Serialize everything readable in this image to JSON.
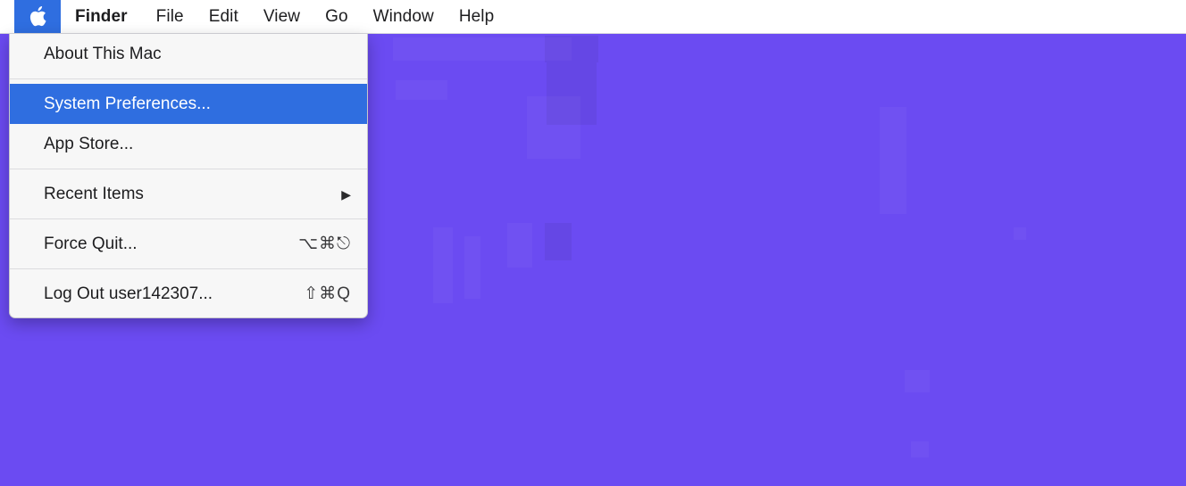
{
  "desktop": {
    "background_color": "#6b4bf2"
  },
  "menubar": {
    "apple_icon": "apple-logo-icon",
    "highlight_color": "#2f6ee0",
    "items": [
      {
        "label": "Finder",
        "bold": true
      },
      {
        "label": "File",
        "bold": false
      },
      {
        "label": "Edit",
        "bold": false
      },
      {
        "label": "View",
        "bold": false
      },
      {
        "label": "Go",
        "bold": false
      },
      {
        "label": "Window",
        "bold": false
      },
      {
        "label": "Help",
        "bold": false
      }
    ]
  },
  "apple_menu": {
    "selected_item": "System Preferences...",
    "items": [
      {
        "label": "About This Mac",
        "shortcut": "",
        "submenu": false,
        "selected": false
      },
      {
        "label": "System Preferences...",
        "shortcut": "",
        "submenu": false,
        "selected": true
      },
      {
        "label": "App Store...",
        "shortcut": "",
        "submenu": false,
        "selected": false
      },
      {
        "label": "Recent Items",
        "shortcut": "",
        "submenu": true,
        "selected": false
      },
      {
        "label": "Force Quit...",
        "shortcut": "⌥⌘⎋",
        "submenu": false,
        "selected": false
      },
      {
        "label": "Log Out user142307...",
        "shortcut": "⇧⌘Q",
        "submenu": false,
        "selected": false
      }
    ]
  }
}
